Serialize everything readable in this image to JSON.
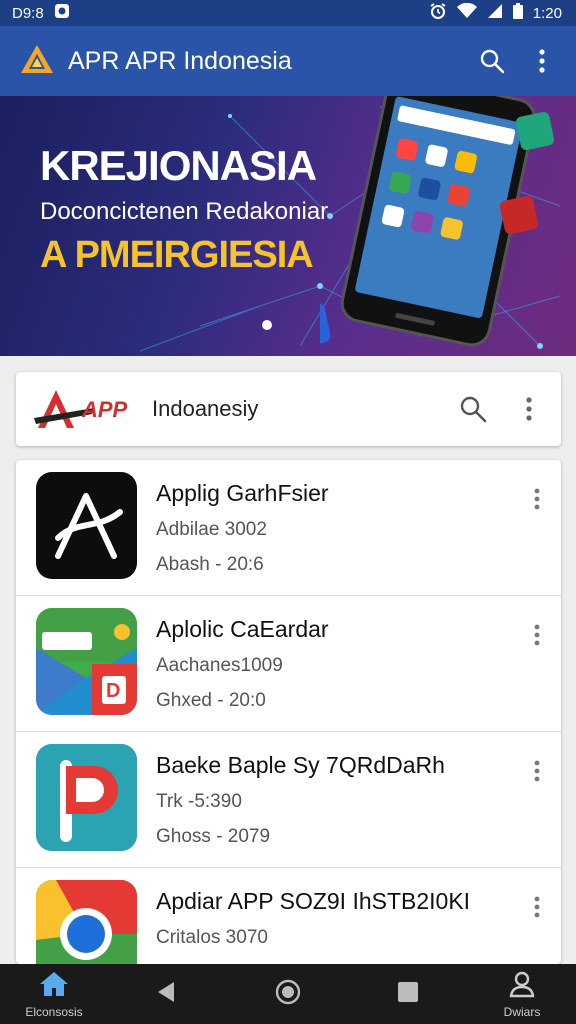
{
  "status_bar": {
    "time": "D9:8",
    "clock": "1:20"
  },
  "app_bar": {
    "title": "APR APR Indonesia"
  },
  "banner": {
    "headline": "KREJIONASIA",
    "subline": "Doconcictenen Redakoniar",
    "highlight": "A PMEIRGIESIA"
  },
  "search_card": {
    "logo_text": "APP",
    "label": "Indoanesiy"
  },
  "apps": [
    {
      "name": "Applig GarhFsier",
      "line1": "Adbilae 3002",
      "line2": "Abash - 20:6"
    },
    {
      "name": "Aplolic CaEardar",
      "line1": "Aachanes1009",
      "line2": "Ghxed - 20:0"
    },
    {
      "name": "Baeke Baple Sy 7QRdDaRh",
      "line1": "Trk -5:390",
      "line2": "Ghoss - 2079"
    },
    {
      "name": "Apdiar APP SOZ9I IhSTB2I0KI",
      "line1": "Critalos 3070",
      "line2": ""
    }
  ],
  "nav": {
    "home_label": "Elconsosis",
    "profile_label": "Dwiars"
  },
  "colors": {
    "app_bar": "#2a54a8",
    "status_bar": "#1d3f86",
    "accent_yellow": "#f5c32c",
    "nav_bg": "#1a1a1a"
  }
}
